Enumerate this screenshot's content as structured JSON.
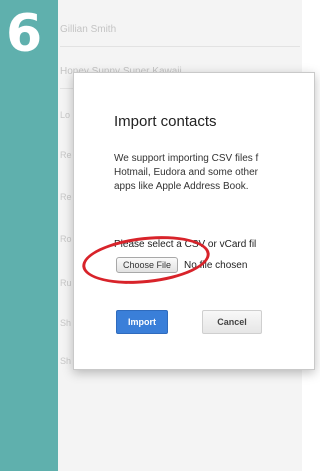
{
  "step_number": "6",
  "background": {
    "contacts": [
      "Gillian Smith",
      "Honey Sunny Super Kawaii"
    ],
    "row_letters": [
      "Lo",
      "Re",
      "Re",
      "Ro",
      "Ru",
      "Sh",
      "Sh"
    ]
  },
  "dialog": {
    "title": "Import contacts",
    "description_lines": [
      "We support importing CSV files f",
      "Hotmail, Eudora and some other",
      "apps like Apple Address Book."
    ],
    "select_prompt": "Please select a CSV or vCard fil",
    "choose_file_label": "Choose File",
    "no_file_text": "No file chosen",
    "import_label": "Import",
    "cancel_label": "Cancel"
  },
  "colors": {
    "accent_bar": "#5fb0ad",
    "import_button": "#3a7fd9",
    "highlight": "#d8232a"
  }
}
